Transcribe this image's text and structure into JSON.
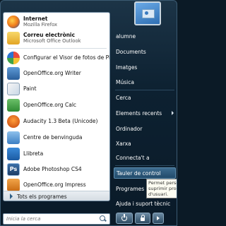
{
  "pinned": [
    {
      "title": "Internet",
      "subtitle": "Mozilla Firefox",
      "icon": "firefox-icon"
    },
    {
      "title": "Correu electrònic",
      "subtitle": "Microsoft Office Outlook",
      "icon": "outlook-icon"
    }
  ],
  "recent": [
    {
      "title": "Configurar el Visor de fotos de Picasa",
      "icon": "picasa-icon"
    },
    {
      "title": "OpenOffice.org Writer",
      "icon": "writer-icon"
    },
    {
      "title": "Paint",
      "icon": "paint-icon"
    },
    {
      "title": "OpenOffice.org Calc",
      "icon": "calc-icon"
    },
    {
      "title": "Audacity 1.3 Beta (Unicode)",
      "icon": "audacity-icon"
    },
    {
      "title": "Centre de benvinguda",
      "icon": "welcome-center-icon"
    },
    {
      "title": "Llibreta",
      "icon": "notebook-icon"
    },
    {
      "title": "Adobe Photoshop CS4",
      "icon": "photoshop-icon",
      "glyph": "Ps"
    },
    {
      "title": "OpenOffice.org Impress",
      "icon": "impress-icon"
    }
  ],
  "all_programs": "Tots els programes",
  "search": {
    "placeholder": "Inicia la cerca"
  },
  "right": [
    "alumne",
    "Documents",
    "Imatges",
    "Música",
    "Cerca",
    "Elements recents",
    "Ordinador",
    "Xarxa",
    "Connecta't a",
    "Tauler de control",
    "Programes per defecte",
    "Ajuda i suport tècnic"
  ],
  "tooltip": [
    "Permet perso",
    "suprimir prog",
    "d'usuari."
  ],
  "colors": {
    "highlight": "#3d6c8f",
    "menu_bg": "#0d2131"
  }
}
